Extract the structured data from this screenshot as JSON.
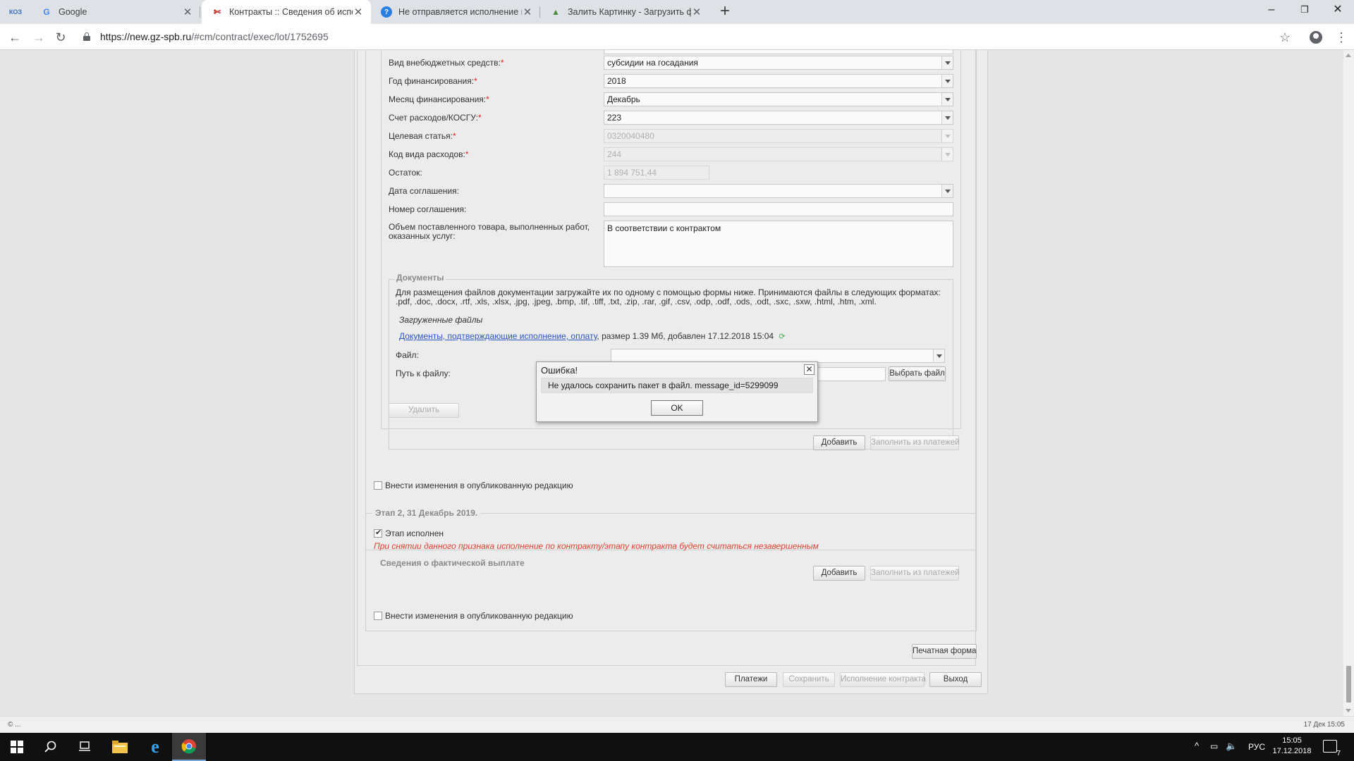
{
  "browser": {
    "tabs": [
      {
        "title": "Google",
        "favicon": "google-icon"
      },
      {
        "title": "Контракты :: Сведения об испол",
        "favicon": "contracts-icon",
        "active": true
      },
      {
        "title": "Не отправляется исполнение в",
        "favicon": "help-icon"
      },
      {
        "title": "Залить Картинку - Загрузить фо",
        "favicon": "image-host-icon"
      }
    ],
    "url_host": "https://new.gz-spb.ru",
    "url_path": "/#cm/contract/exec/lot/1752695"
  },
  "form": {
    "fields": [
      {
        "label": "Вид внебюджетных средств:",
        "required": true,
        "value": "субсидии на госадания",
        "type": "select",
        "disabled": false
      },
      {
        "label": "Год финансирования:",
        "required": true,
        "value": "2018",
        "type": "select",
        "disabled": false
      },
      {
        "label": "Месяц финансирования:",
        "required": true,
        "value": "Декабрь",
        "type": "select",
        "disabled": false
      },
      {
        "label": "Счет расходов/КОСГУ:",
        "required": true,
        "value": "223",
        "type": "select",
        "disabled": false
      },
      {
        "label": "Целевая статья:",
        "required": true,
        "value": "0320040480",
        "type": "select",
        "disabled": true
      },
      {
        "label": "Код вида расходов:",
        "required": true,
        "value": "244",
        "type": "select",
        "disabled": true
      },
      {
        "label": "Остаток:",
        "required": false,
        "value": "1 894 751,44",
        "type": "text",
        "disabled": true
      },
      {
        "label": "Дата соглашения:",
        "required": false,
        "value": "",
        "type": "date",
        "disabled": false
      },
      {
        "label": "Номер соглашения:",
        "required": false,
        "value": "",
        "type": "text",
        "disabled": false
      }
    ],
    "volume_label": "Объем поставленного товара, выполненных работ, оказанных услуг:",
    "volume_value": "В соответствии с контрактом"
  },
  "documents": {
    "legend": "Документы",
    "hint": "Для размещения файлов документации загружайте их по одному с помощью формы ниже. Принимаются файлы в следующих форматах: .pdf, .doc, .docx, .rtf, .xls, .xlsx, .jpg, .jpeg, .bmp, .tif, .tiff, .txt, .zip, .rar, .gif, .csv, .odp, .odf, .ods, .odt, .sxc, .sxw, .html, .htm, .xml.",
    "uploaded_title": "Загруженные файлы",
    "file_link": "Документы, подтверждающие исполнение, оплату",
    "file_info": ", размер 1.39 Мб, добавлен 17.12.2018 15:04",
    "file_label": "Файл:",
    "path_label": "Путь к файлу:",
    "choose_button": "Выбрать файл",
    "delete_button": "Удалить"
  },
  "stage1": {
    "add_button": "Добавить",
    "fill_button": "Заполнить из платежей",
    "changes_checkbox": "Внести изменения в опубликованную редакцию"
  },
  "stage2": {
    "legend": "Этап 2, 31 Декабрь 2019.",
    "done_checkbox": "Этап исполнен",
    "warning": "При снятии данного признака исполнение по контракту/этапу контракта будет считаться незавершенным",
    "payment_title": "Сведения о фактической выплате",
    "add_button": "Добавить",
    "fill_button": "Заполнить из платежей",
    "changes_checkbox": "Внести изменения в опубликованную редакцию"
  },
  "footer": {
    "print_button": "Печатная форма",
    "payments_button": "Платежи",
    "save_button": "Сохранить",
    "execution_button": "Исполнение контракта",
    "exit_button": "Выход"
  },
  "modal": {
    "title": "Ошибка!",
    "message": "Не удалось сохранить пакет в файл. message_id=5299099",
    "ok": "OK"
  },
  "status": {
    "left": "© ...",
    "right": "17 Дек 15:05"
  },
  "taskbar": {
    "lang": "РУС",
    "time": "15:05",
    "date": "17.12.2018",
    "notifications": "7"
  }
}
